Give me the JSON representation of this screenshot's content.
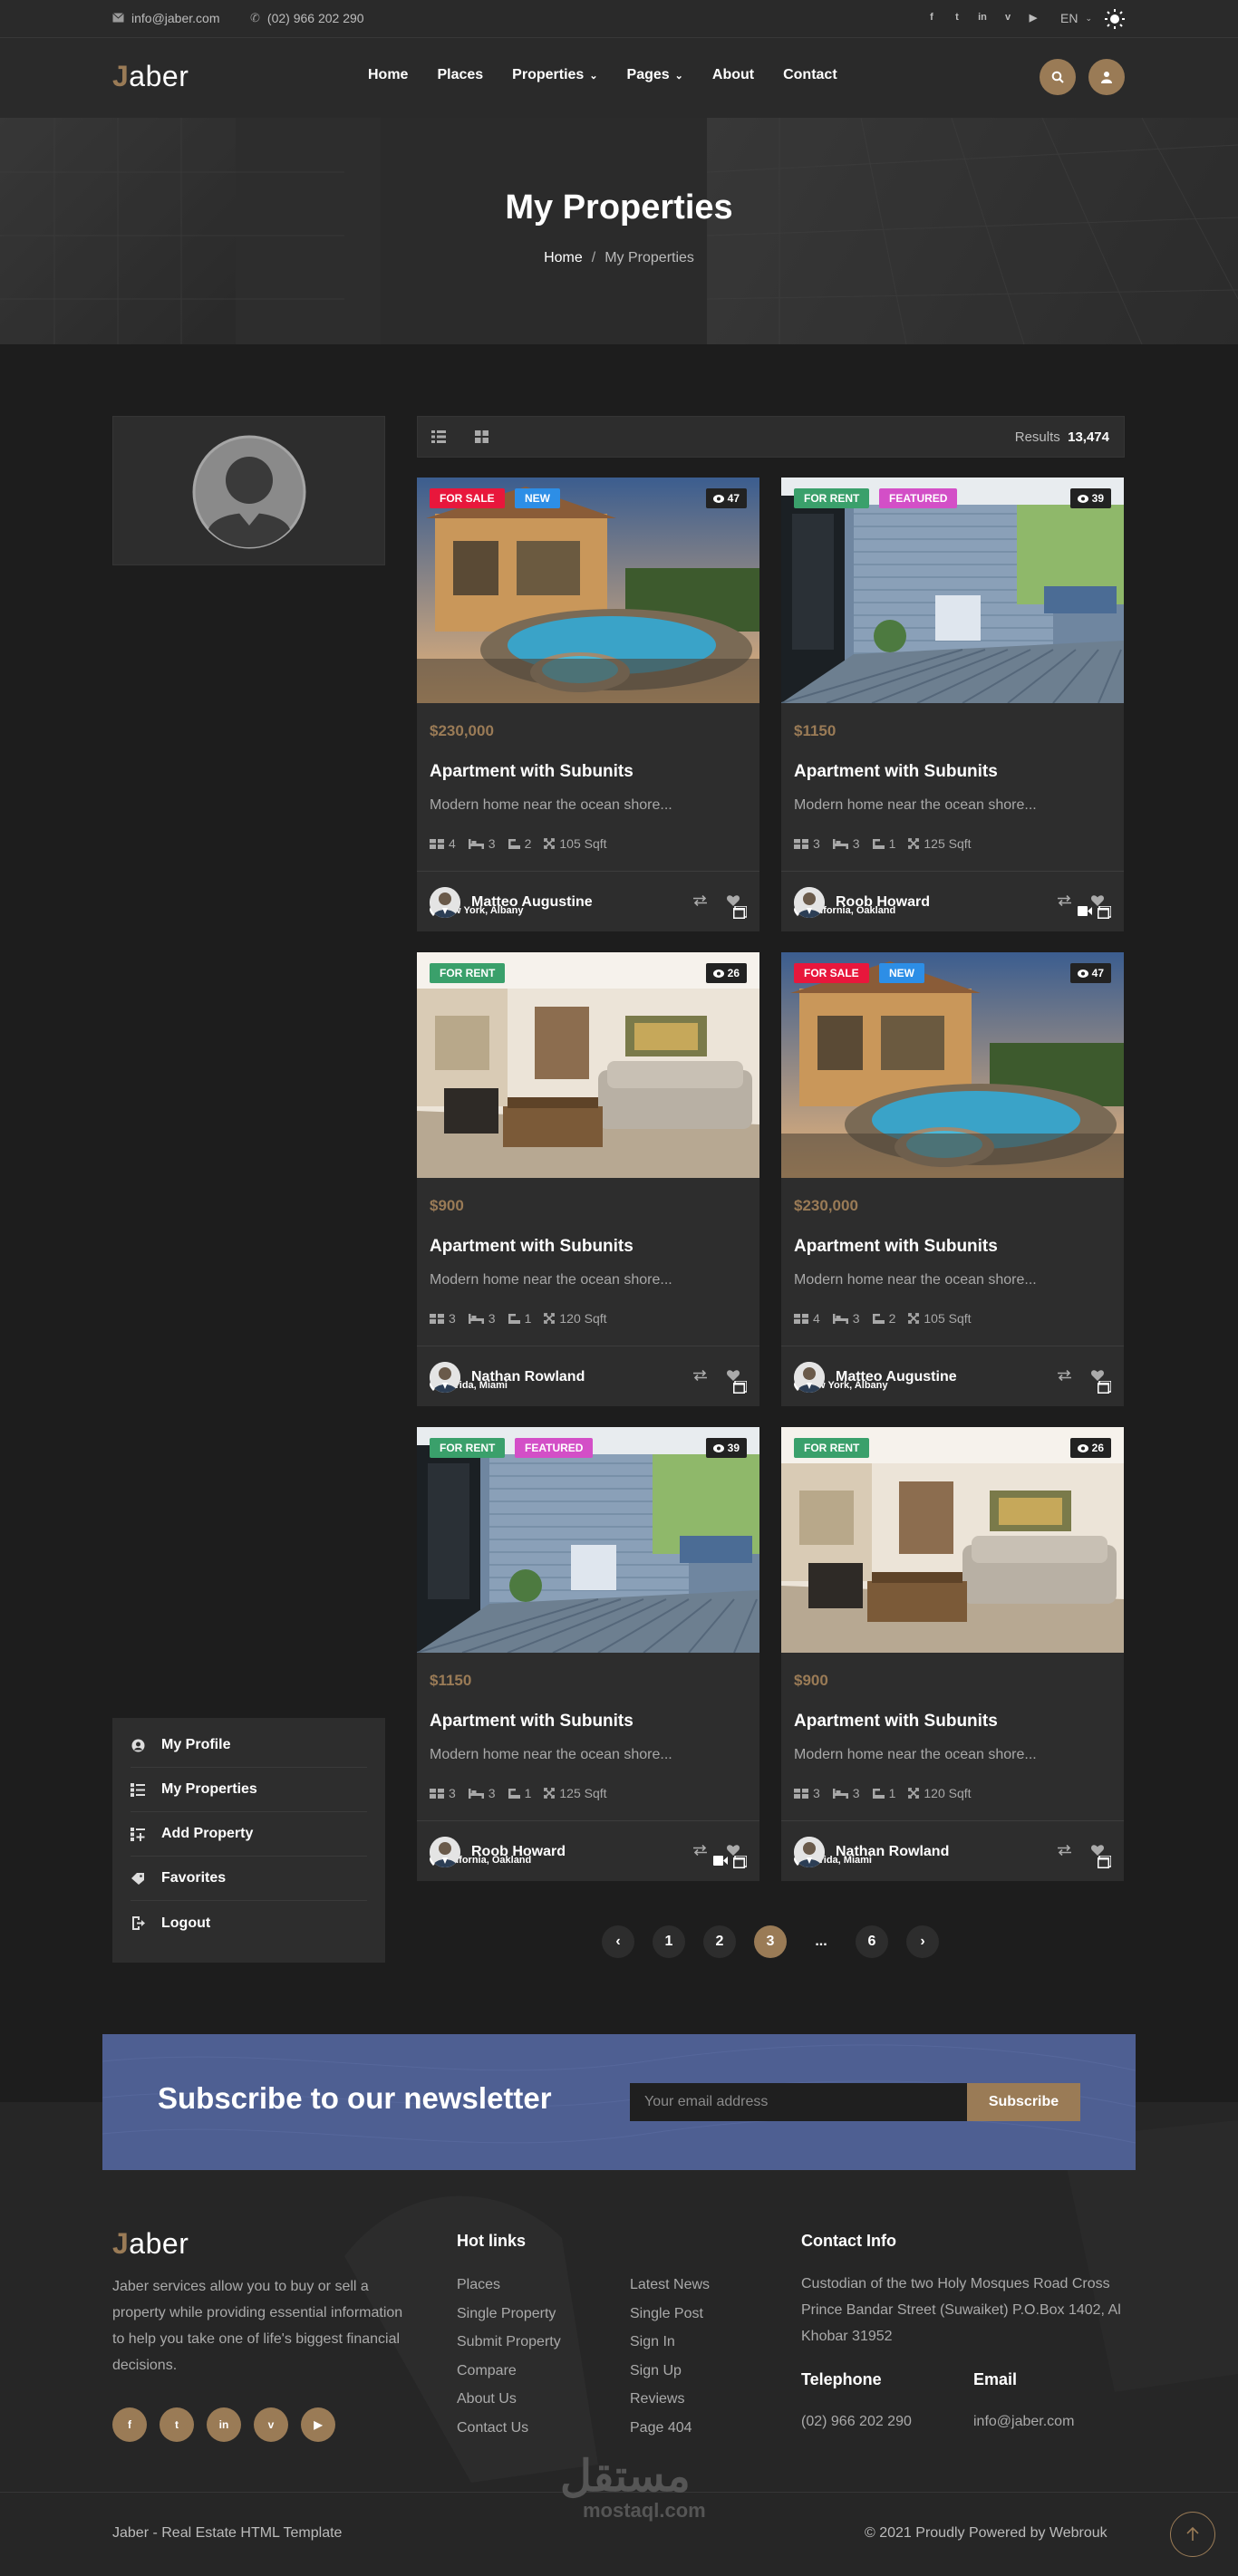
{
  "topbar": {
    "email": "info@jaber.com",
    "phone": "(02) 966 202 290",
    "language": "EN",
    "social_icons": [
      "facebook-icon",
      "twitter-icon",
      "linkedin-icon",
      "vimeo-icon",
      "youtube-icon"
    ]
  },
  "header": {
    "logo_initial": "J",
    "logo_rest": "aber",
    "nav": [
      {
        "label": "Home"
      },
      {
        "label": "Places"
      },
      {
        "label": "Properties"
      },
      {
        "label": "Pages"
      },
      {
        "label": "About"
      },
      {
        "label": "Contact"
      }
    ]
  },
  "hero": {
    "title": "My Properties",
    "breadcrumb_home": "Home",
    "breadcrumb_sep": "/",
    "breadcrumb_current": "My Properties"
  },
  "toolbar": {
    "results_label": "Results",
    "results_count": "13,474"
  },
  "sidebar_menu": [
    {
      "label": "My Profile",
      "icon": "user-icon"
    },
    {
      "label": "My Properties",
      "icon": "list-icon"
    },
    {
      "label": "Add Property",
      "icon": "add-list-icon"
    },
    {
      "label": "Favorites",
      "icon": "tag-icon"
    },
    {
      "label": "Logout",
      "icon": "logout-icon"
    }
  ],
  "cards": [
    {
      "badges": [
        "FOR SALE",
        "NEW"
      ],
      "views": "47",
      "location": "New York,  Albany",
      "price": "$230,000",
      "title": "Apartment with Subunits",
      "desc": "Modern home near the ocean shore...",
      "beds": "4",
      "baths": "3",
      "garage": "2",
      "area": "105 Sqft",
      "agent": "Matteo Augustine",
      "scene": "pool",
      "video": false
    },
    {
      "badges": [
        "FOR RENT",
        "FEATURED"
      ],
      "views": "39",
      "location": "California,  Oakland",
      "price": "$1150",
      "title": "Apartment with Subunits",
      "desc": "Modern home near the ocean shore...",
      "beds": "3",
      "baths": "3",
      "garage": "1",
      "area": "125 Sqft",
      "agent": "Roob Howard",
      "scene": "porch",
      "video": true
    },
    {
      "badges": [
        "FOR RENT"
      ],
      "views": "26",
      "location": "Florida,  Miami",
      "price": "$900",
      "title": "Apartment with Subunits",
      "desc": "Modern home near the ocean shore...",
      "beds": "3",
      "baths": "3",
      "garage": "1",
      "area": "120 Sqft",
      "agent": "Nathan Rowland",
      "scene": "living",
      "video": false
    },
    {
      "badges": [
        "FOR SALE",
        "NEW"
      ],
      "views": "47",
      "location": "New York,  Albany",
      "price": "$230,000",
      "title": "Apartment with Subunits",
      "desc": "Modern home near the ocean shore...",
      "beds": "4",
      "baths": "3",
      "garage": "2",
      "area": "105 Sqft",
      "agent": "Matteo Augustine",
      "scene": "pool",
      "video": false
    },
    {
      "badges": [
        "FOR RENT",
        "FEATURED"
      ],
      "views": "39",
      "location": "California,  Oakland",
      "price": "$1150",
      "title": "Apartment with Subunits",
      "desc": "Modern home near the ocean shore...",
      "beds": "3",
      "baths": "3",
      "garage": "1",
      "area": "125 Sqft",
      "agent": "Roob Howard",
      "scene": "porch",
      "video": true
    },
    {
      "badges": [
        "FOR RENT"
      ],
      "views": "26",
      "location": "Florida,  Miami",
      "price": "$900",
      "title": "Apartment with Subunits",
      "desc": "Modern home near the ocean shore...",
      "beds": "3",
      "baths": "3",
      "garage": "1",
      "area": "120 Sqft",
      "agent": "Nathan Rowland",
      "scene": "living",
      "video": false
    }
  ],
  "badge_colors": {
    "FOR SALE": "#e8173c",
    "NEW": "#2d8ee6",
    "FOR RENT": "#3aa06b",
    "FEATURED": "#d34fc7"
  },
  "pagination": {
    "pages": [
      "1",
      "2",
      "3",
      "...",
      "6"
    ],
    "active": "3"
  },
  "newsletter": {
    "title": "Subscribe to our newsletter",
    "placeholder": "Your email address",
    "button": "Subscribe"
  },
  "footer": {
    "about": "Jaber services allow you to buy or sell a property while providing essential information to help you take one of life's biggest financial decisions.",
    "hot_links_title": "Hot links",
    "links_col1": [
      "Places",
      "Single Property",
      "Submit Property",
      "Compare",
      "About Us",
      "Contact Us"
    ],
    "links_col2": [
      "Latest News",
      "Single Post",
      "Sign In",
      "Sign Up",
      "Reviews",
      "Page 404"
    ],
    "contact_title": "Contact Info",
    "address": "Custodian of the two Holy Mosques Road Cross Prince Bandar Street (Suwaiket) P.O.Box 1402, Al Khobar 31952",
    "telephone_title": "Telephone",
    "telephone": "(02) 966 202 290",
    "email_title": "Email",
    "email": "info@jaber.com",
    "social": [
      "f",
      "t",
      "in",
      "v",
      "▶"
    ],
    "copyright_left": "Jaber - Real Estate HTML Template",
    "copyright_right": "© 2021 Proudly Powered by Webrouk",
    "watermark": "مستقل",
    "watermark_sub": "mostaql.com"
  },
  "colors": {
    "accent": "#9a7b56",
    "newsletter_bg": "#4e5f92",
    "panel": "#2d2d2d"
  }
}
